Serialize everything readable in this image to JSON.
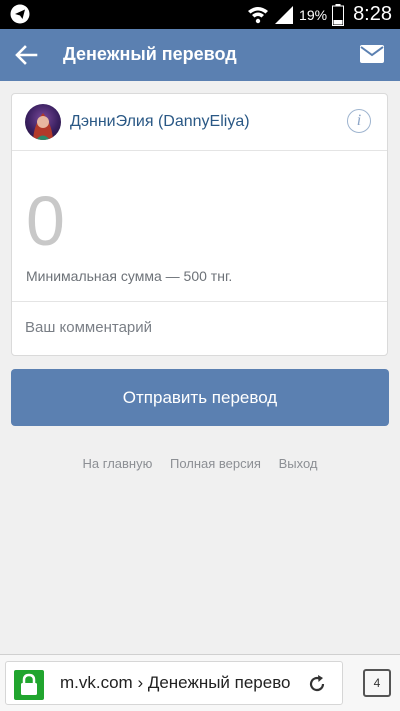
{
  "status_bar": {
    "battery_percent": "19%",
    "time": "8:28",
    "icons": [
      "telegram-icon",
      "wifi-icon",
      "signal-icon",
      "battery-icon"
    ]
  },
  "header": {
    "title": "Денежный перевод",
    "back_icon": "arrow-left-icon",
    "mail_icon": "envelope-icon"
  },
  "transfer": {
    "recipient_name": "ДэнниЭлия (DannyEliya)",
    "info_symbol": "i",
    "amount": "0",
    "min_sum_text": "Минимальная сумма — 500 тнг.",
    "comment_placeholder": "Ваш комментарий",
    "comment_value": "",
    "submit_label": "Отправить перевод"
  },
  "footer": {
    "links": [
      "На главную",
      "Полная версия",
      "Выход"
    ]
  },
  "browser": {
    "url_text": "m.vk.com › Денежный перевод",
    "tab_count": "4"
  },
  "colors": {
    "accent": "#5b80b1",
    "link": "#2a5885",
    "secure": "#21a52e"
  }
}
